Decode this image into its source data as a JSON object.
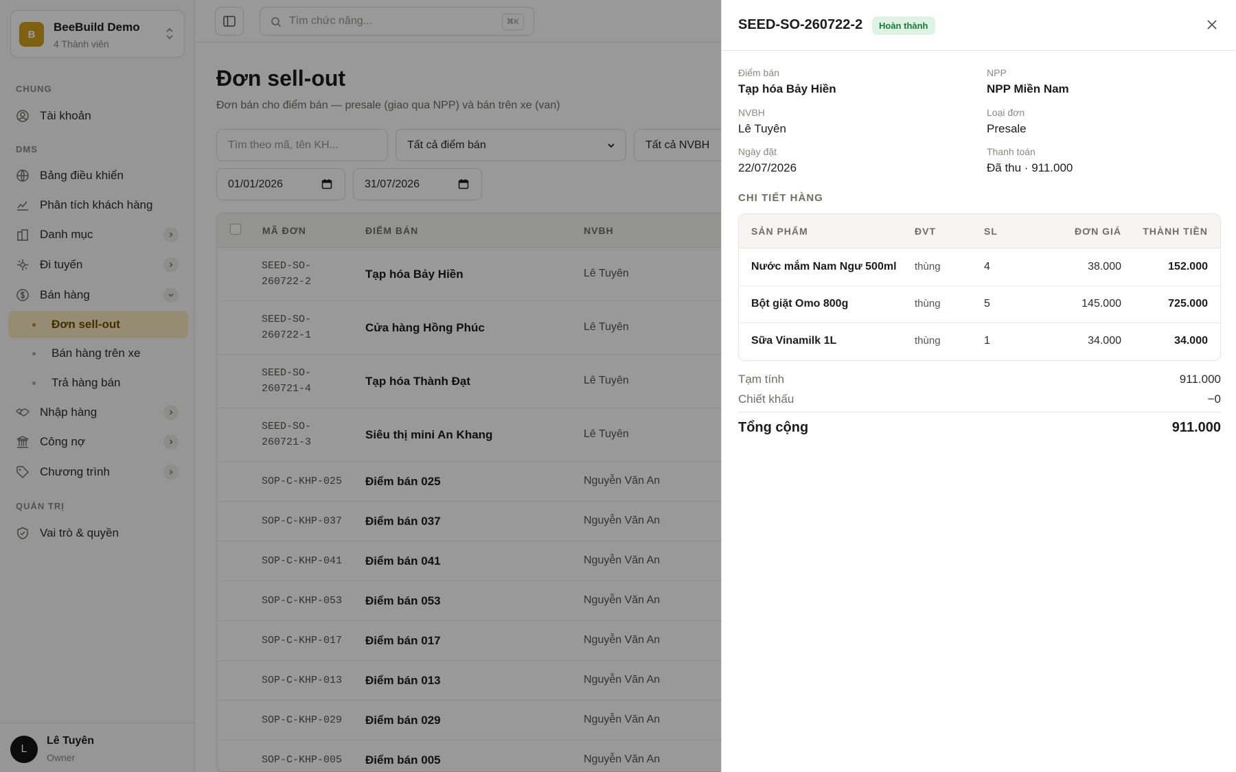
{
  "org": {
    "initial": "B",
    "name": "BeeBuild Demo",
    "members": "4 Thành viên"
  },
  "nav": {
    "section_general": "CHUNG",
    "account": "Tài khoản",
    "section_dms": "DMS",
    "dashboard": "Bảng điều khiển",
    "customer_analytics": "Phân tích khách hàng",
    "catalog": "Danh mục",
    "routes": "Đi tuyến",
    "sales": "Bán hàng",
    "sales_children": [
      "Đơn sell-out",
      "Bán hàng trên xe",
      "Trả hàng bán"
    ],
    "purchasing": "Nhập hàng",
    "debt": "Công nợ",
    "programs": "Chương trình",
    "section_admin": "QUẢN TRỊ",
    "roles": "Vai trò & quyền"
  },
  "user": {
    "initial": "L",
    "name": "Lê Tuyên",
    "role": "Owner"
  },
  "search": {
    "placeholder": "Tìm chức năng...",
    "shortcut": "⌘K"
  },
  "page": {
    "title": "Đơn sell-out",
    "subtitle": "Đơn bán cho điểm bán — presale (giao qua NPP) và bán trên xe (van)"
  },
  "filters": {
    "search_placeholder": "Tìm theo mã, tên KH...",
    "store_select": "Tất cả điểm bán",
    "rep_select": "Tất cả NVBH",
    "date_from": "01/01/2026",
    "date_to": "31/07/2026"
  },
  "table": {
    "headers": {
      "code": "MÃ ĐƠN",
      "store": "ĐIỂM BÁN",
      "rep": "NVBH"
    },
    "rows": [
      {
        "code_a": "SEED-SO-",
        "code_b": "260722-2",
        "store": "Tạp hóa Bảy Hiền",
        "rep": "Lê Tuyên"
      },
      {
        "code_a": "SEED-SO-",
        "code_b": "260722-1",
        "store": "Cửa hàng Hồng Phúc",
        "rep": "Lê Tuyên"
      },
      {
        "code_a": "SEED-SO-",
        "code_b": "260721-4",
        "store": "Tạp hóa Thành Đạt",
        "rep": "Lê Tuyên"
      },
      {
        "code_a": "SEED-SO-",
        "code_b": "260721-3",
        "store": "Siêu thị mini An Khang",
        "rep": "Lê Tuyên"
      },
      {
        "code_a": "SOP-C-KHP-025",
        "code_b": "",
        "store": "Điểm bán 025",
        "rep": "Nguyễn Văn An"
      },
      {
        "code_a": "SOP-C-KHP-037",
        "code_b": "",
        "store": "Điểm bán 037",
        "rep": "Nguyễn Văn An"
      },
      {
        "code_a": "SOP-C-KHP-041",
        "code_b": "",
        "store": "Điểm bán 041",
        "rep": "Nguyễn Văn An"
      },
      {
        "code_a": "SOP-C-KHP-053",
        "code_b": "",
        "store": "Điểm bán 053",
        "rep": "Nguyễn Văn An"
      },
      {
        "code_a": "SOP-C-KHP-017",
        "code_b": "",
        "store": "Điểm bán 017",
        "rep": "Nguyễn Văn An"
      },
      {
        "code_a": "SOP-C-KHP-013",
        "code_b": "",
        "store": "Điểm bán 013",
        "rep": "Nguyễn Văn An"
      },
      {
        "code_a": "SOP-C-KHP-029",
        "code_b": "",
        "store": "Điểm bán 029",
        "rep": "Nguyễn Văn An"
      },
      {
        "code_a": "SOP-C-KHP-005",
        "code_b": "",
        "store": "Điểm bán 005",
        "rep": "Nguyễn Văn An"
      }
    ]
  },
  "drawer": {
    "title": "SEED-SO-260722-2",
    "status": "Hoàn thành",
    "status_color": "#1b7a3b",
    "fields": {
      "store_label": "Điểm bán",
      "store": "Tạp hóa Bảy Hiền",
      "npp_label": "NPP",
      "npp": "NPP Miền Nam",
      "rep_label": "NVBH",
      "rep": "Lê Tuyên",
      "type_label": "Loại đơn",
      "type": "Presale",
      "date_label": "Ngày đặt",
      "date": "22/07/2026",
      "payment_label": "Thanh toán",
      "payment": "Đã thu · 911.000"
    },
    "items_title": "CHI TIẾT HÀNG",
    "item_headers": {
      "product": "SẢN PHẨM",
      "unit": "ĐVT",
      "qty": "SL",
      "price": "ĐƠN GIÁ",
      "total": "THÀNH TIỀN"
    },
    "items": [
      {
        "name": "Nước mắm Nam Ngư 500ml",
        "unit": "thùng",
        "qty": "4",
        "price": "38.000",
        "total": "152.000"
      },
      {
        "name": "Bột giặt Omo 800g",
        "unit": "thùng",
        "qty": "5",
        "price": "145.000",
        "total": "725.000"
      },
      {
        "name": "Sữa Vinamilk 1L",
        "unit": "thùng",
        "qty": "1",
        "price": "34.000",
        "total": "34.000"
      }
    ],
    "subtotal_label": "Tạm tính",
    "subtotal": "911.000",
    "discount_label": "Chiết khấu",
    "discount": "−0",
    "grand_total_label": "Tổng cộng",
    "grand_total": "911.000"
  }
}
